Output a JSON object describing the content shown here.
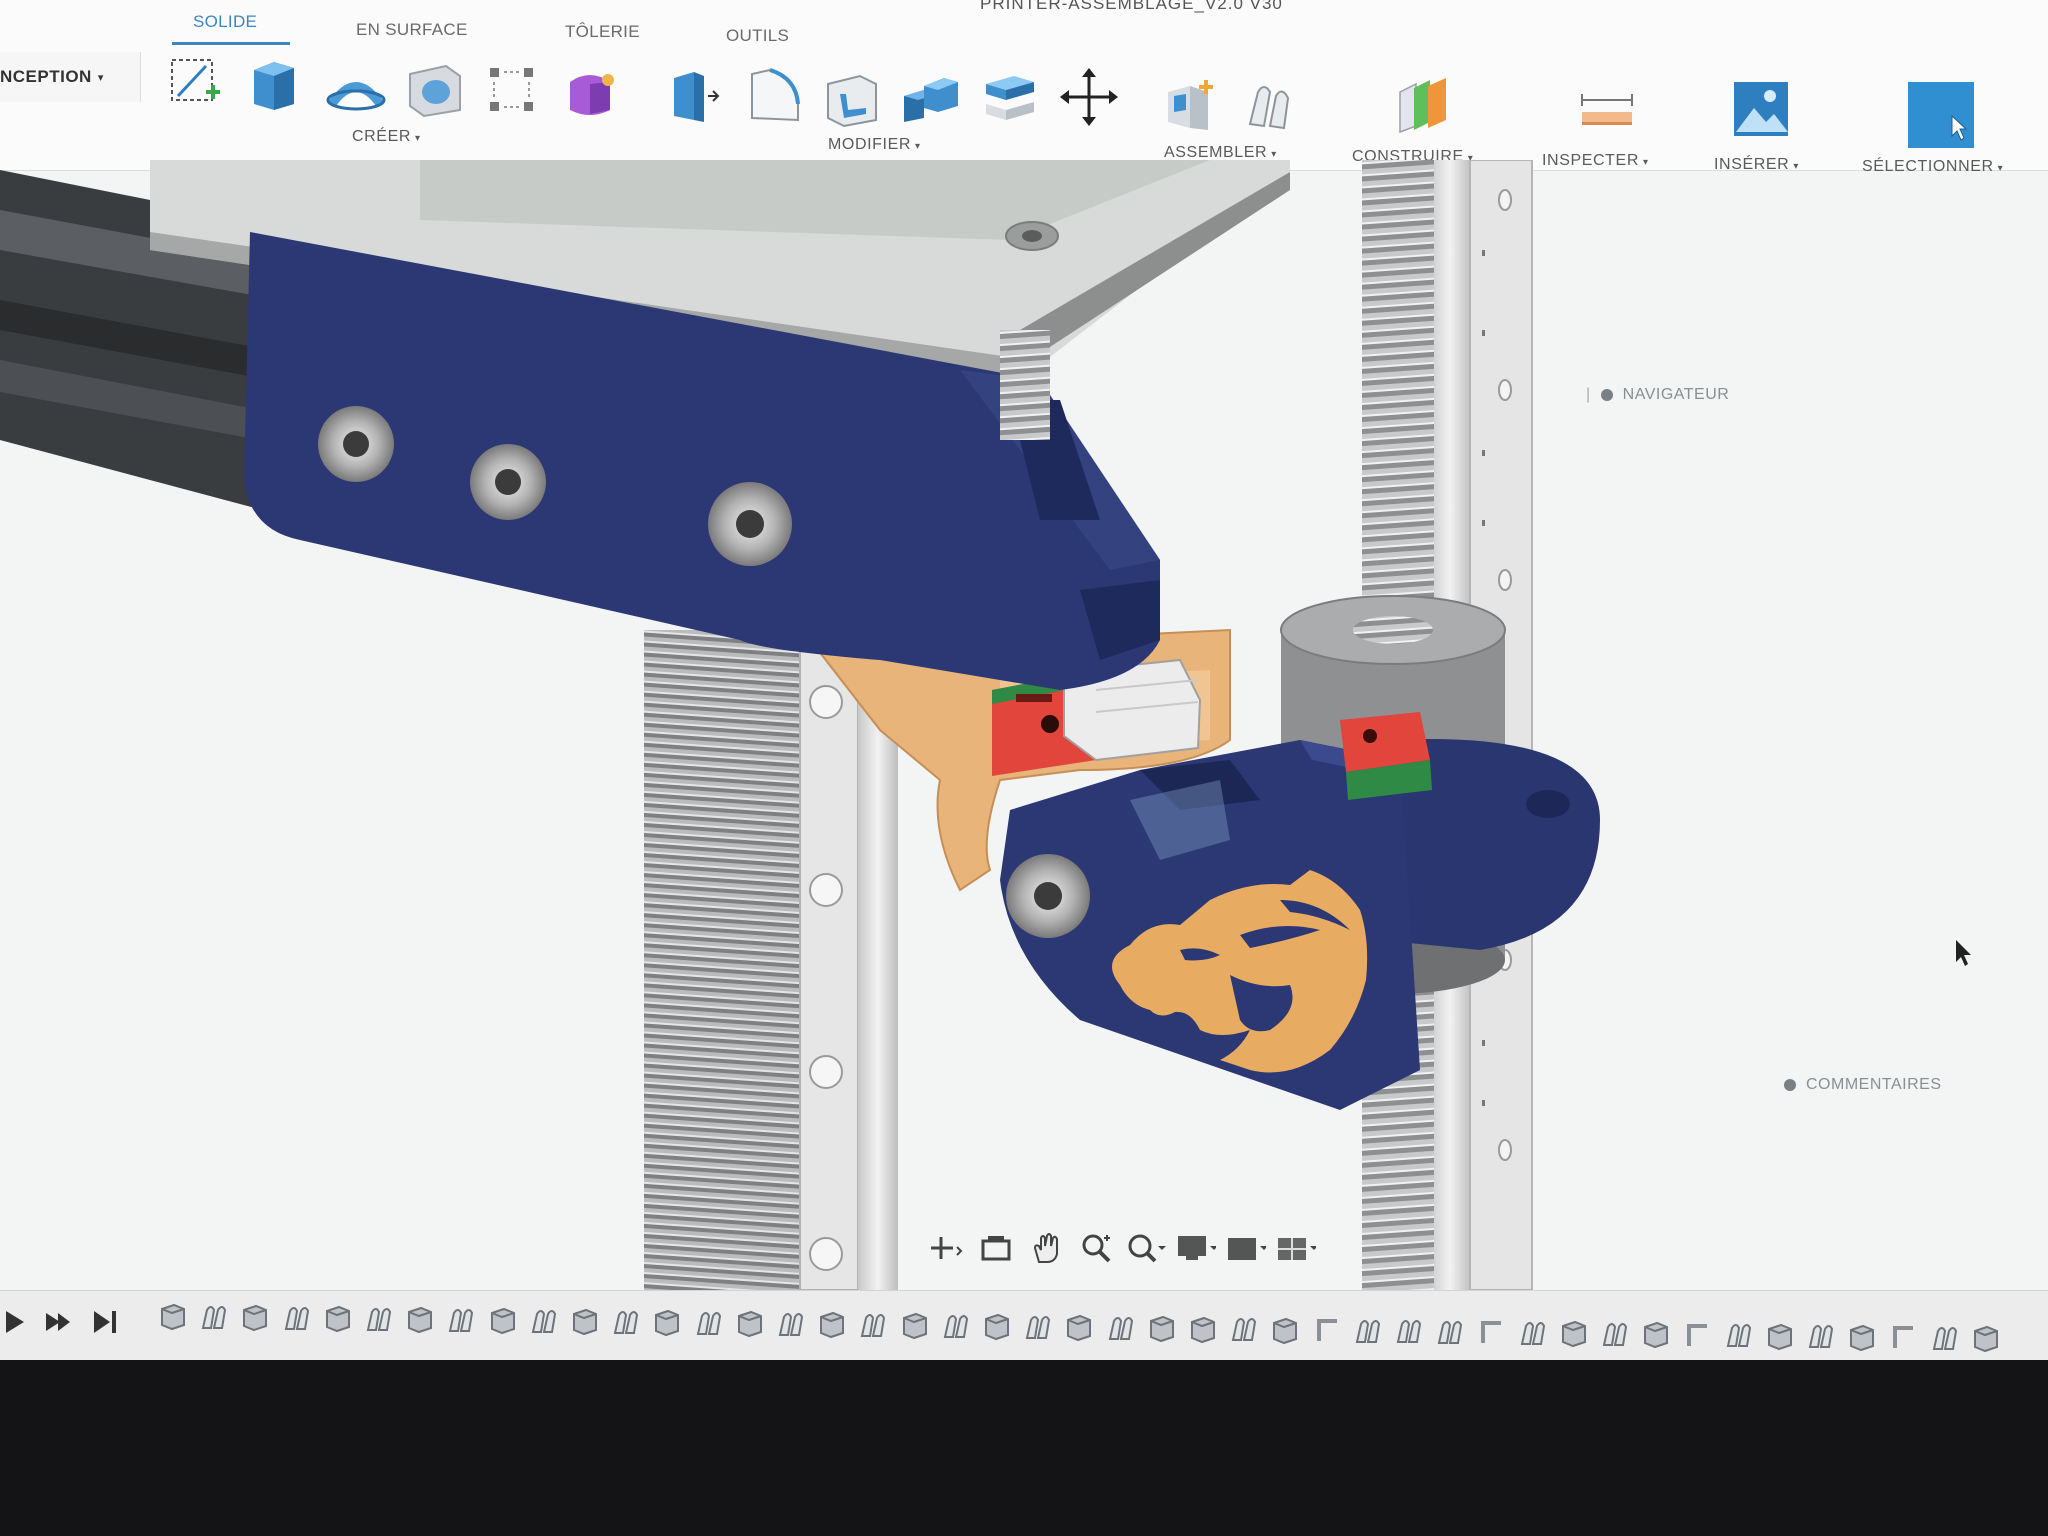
{
  "window": {
    "title": "PRINTER-ASSEMBLAGE_V2.0 V30"
  },
  "workspace": {
    "label": "NCEPTION"
  },
  "tabs": [
    {
      "label": "SOLIDE",
      "active": true
    },
    {
      "label": "EN SURFACE",
      "active": false
    },
    {
      "label": "TÔLERIE",
      "active": false
    },
    {
      "label": "OUTILS",
      "active": false
    }
  ],
  "groups": {
    "creer": "CRÉER",
    "modifier": "MODIFIER",
    "assembler": "ASSEMBLER",
    "construire": "CONSTRUIRE",
    "inspecter": "INSPECTER",
    "inserer": "INSÉRER",
    "selectionner": "SÉLECTIONNER"
  },
  "panels": {
    "navigator": "NAVIGATEUR",
    "comments": "COMMENTAIRES"
  },
  "colors": {
    "accent": "#3b87c4",
    "part_navy": "#2b3873",
    "part_tan": "#e8b47a",
    "part_red": "#e1453b",
    "part_green": "#2f8a46"
  },
  "timeline": {
    "controls": [
      "play-icon",
      "step-forward-icon",
      "skip-end-icon"
    ]
  }
}
